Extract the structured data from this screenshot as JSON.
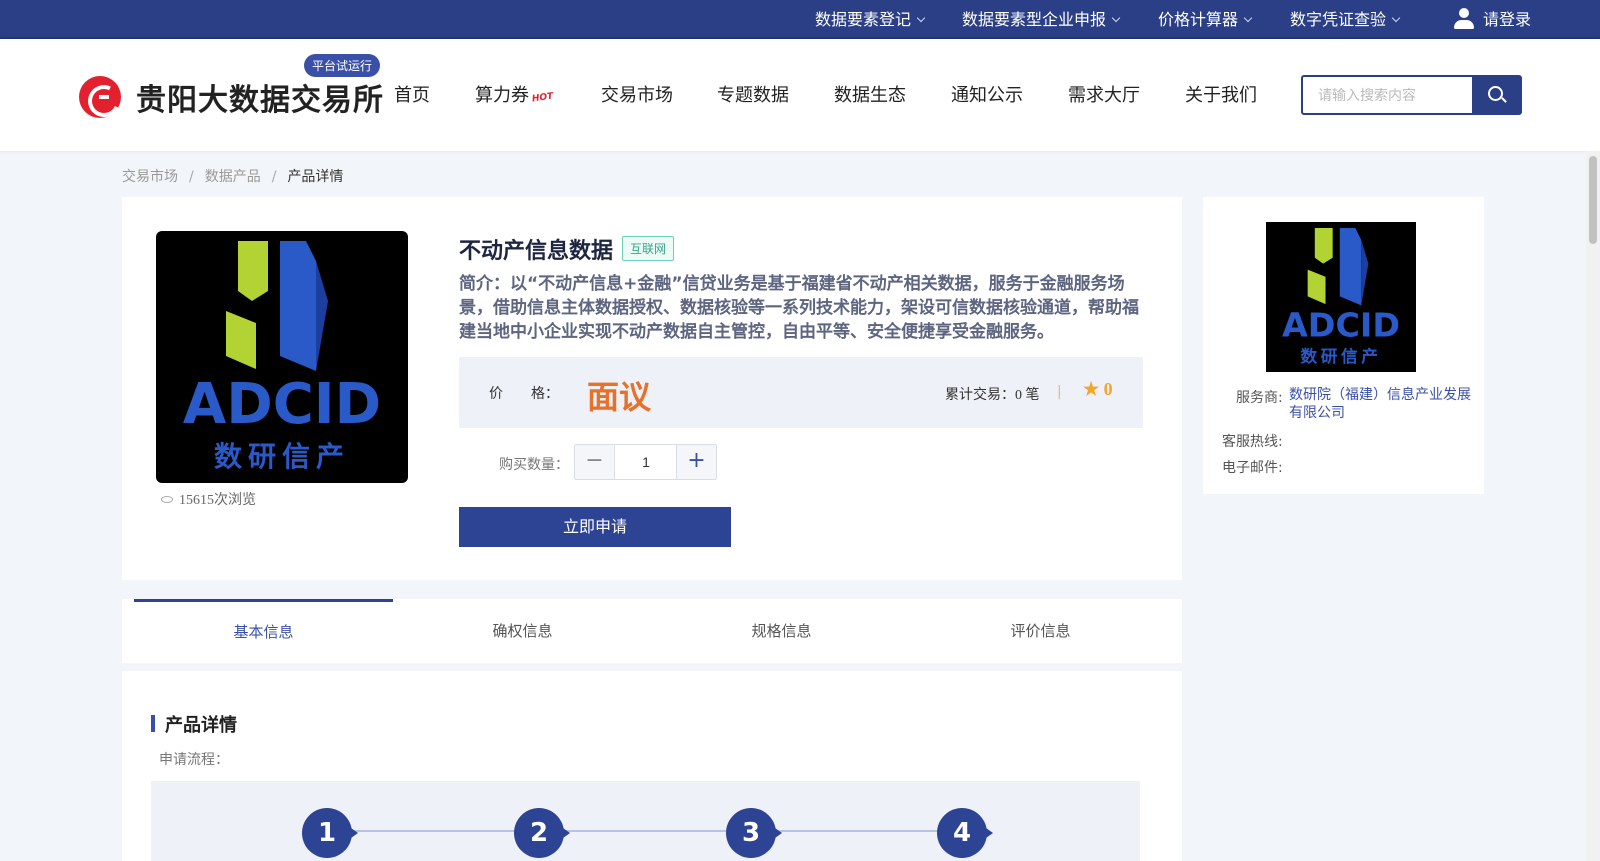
{
  "topbar": {
    "menus": [
      {
        "label": "数据要素登记"
      },
      {
        "label": "数据要素型企业申报"
      },
      {
        "label": "价格计算器"
      },
      {
        "label": "数字凭证查验"
      }
    ],
    "login": "请登录"
  },
  "header": {
    "brand": "贵阳大数据交易所",
    "trial_badge": "平台试运行",
    "nav": [
      "首页",
      "算力券",
      "交易市场",
      "专题数据",
      "数据生态",
      "通知公示",
      "需求大厅",
      "关于我们"
    ],
    "hot_badge": "HOT",
    "search_placeholder": "请输入搜索内容"
  },
  "breadcrumb": [
    "交易市场",
    "数据产品",
    "产品详情"
  ],
  "breadcrumb_sep": "/",
  "product": {
    "logo_text": "ADCID",
    "logo_subtext": "数研信产",
    "views": "15615次浏览",
    "title": "不动产信息数据",
    "tag": "互联网",
    "intro": "简介：以“不动产信息+金融”信贷业务是基于福建省不动产相关数据，服务于金融服务场景，借助信息主体数据授权、数据核验等一系列技术能力，架设可信数据核验通道，帮助福建当地中小企业实现不动产数据自主管控，自由平等、安全便捷享受金融服务。",
    "price_label": "价　　格：",
    "price": "面议",
    "trade_count": "累计交易：0 笔",
    "rating": "0",
    "qty_label": "购买数量：",
    "qty": "1",
    "apply": "立即申请"
  },
  "vendor": {
    "provider_label": "服务商:",
    "provider": "数研院（福建）信息产业发展有限公司",
    "hotline_label": "客服热线:",
    "email_label": "电子邮件:"
  },
  "tabs": [
    "基本信息",
    "确权信息",
    "规格信息",
    "评价信息"
  ],
  "details": {
    "section_title": "产品详情",
    "flow_label": "申请流程：",
    "steps": [
      "1",
      "2",
      "3",
      "4"
    ]
  },
  "colors": {
    "primary": "#2d4393",
    "price": "#e8712a",
    "logo_red": "#e3202e"
  }
}
